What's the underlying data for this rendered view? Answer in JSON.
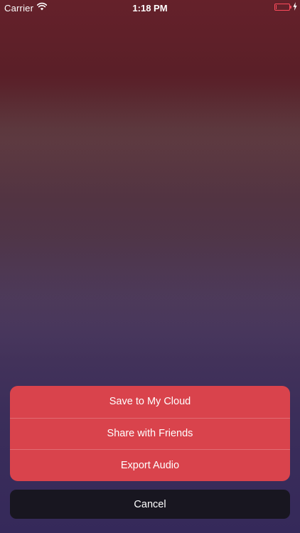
{
  "status_bar": {
    "carrier": "Carrier",
    "time": "1:18 PM",
    "icons": [
      "wifi-icon",
      "battery-icon",
      "charging-bolt-icon"
    ],
    "battery_level_fraction": 0.05
  },
  "action_sheet": {
    "actions": [
      {
        "label": "Save to My Cloud"
      },
      {
        "label": "Share with Friends"
      },
      {
        "label": "Export Audio"
      }
    ],
    "cancel_label": "Cancel"
  },
  "colors": {
    "action_background": "#d9434c",
    "cancel_background": "#181620",
    "battery_low": "#ff4b5c",
    "background_top": "#65212a",
    "background_bottom": "#35295a"
  }
}
